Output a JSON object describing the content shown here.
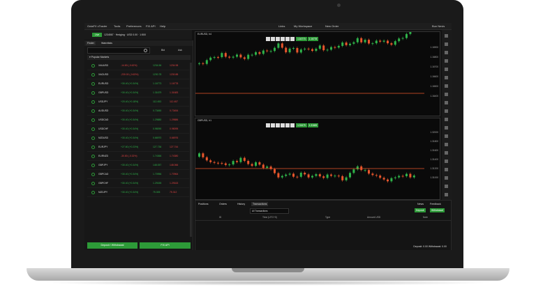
{
  "menu": [
    "OctaFX cTrader",
    "Tools",
    "Preferences",
    "FIX API",
    "Help"
  ],
  "menu_right": [
    "Links",
    "My Workspace",
    "New Order",
    "Bun Nevis"
  ],
  "account": {
    "live": "Live",
    "info": "1234567 · Hedging · USD 0.00 · 1:500"
  },
  "left_tabs": [
    "Finder",
    "Watchlists"
  ],
  "watchlist_headers": {
    "bid": "Bid",
    "ask": "Ask"
  },
  "group": "Popular Markets",
  "rows": [
    {
      "sym": "XAUUSD",
      "chg": "-14.80 (-0.62%)",
      "bid": "1234.56",
      "ask": "1234.98",
      "dir": "neg"
    },
    {
      "sym": "XAGUSD",
      "chg": "-230.00 (-0.63%)",
      "bid": "1230.78",
      "ask": "1230.88",
      "dir": "neg"
    },
    {
      "sym": "EURUSD",
      "chg": "+30.40 (+0.34%)",
      "bid": "1.16773",
      "ask": "1.16778",
      "dir": "pos"
    },
    {
      "sym": "GBPUSD",
      "chg": "+30.40 (+0.34%)",
      "bid": "1.31679",
      "ask": "1.31683",
      "dir": "pos"
    },
    {
      "sym": "USDJPY",
      "chg": "+20.40 (+0.18%)",
      "bid": "112.453",
      "ask": "112.457",
      "dir": "pos"
    },
    {
      "sym": "AUDUSD",
      "chg": "+30.40 (+0.34%)",
      "bid": "0.73450",
      "ask": "0.73454",
      "dir": "pos"
    },
    {
      "sym": "USDCAD",
      "chg": "+30.40 (+0.34%)",
      "bid": "1.29880",
      "ask": "1.29886",
      "dir": "pos"
    },
    {
      "sym": "USDCHF",
      "chg": "+30.40 (+0.34%)",
      "bid": "0.98090",
      "ask": "0.98095",
      "dir": "pos"
    },
    {
      "sym": "NZDUSD",
      "chg": "+30.40 (+0.34%)",
      "bid": "0.66970",
      "ask": "0.66976",
      "dir": "pos"
    },
    {
      "sym": "EURJPY",
      "chg": "+27.60 (+0.23%)",
      "bid": "127.736",
      "ask": "127.744",
      "dir": "pos"
    },
    {
      "sym": "EURNZD",
      "chg": "-30.80 (-0.32%)",
      "bid": "1.74366",
      "ask": "1.74380",
      "dir": "neg"
    },
    {
      "sym": "GBPJPY",
      "chg": "+30.40 (+0.34%)",
      "bid": "148.057",
      "ask": "148.066",
      "dir": "pos"
    },
    {
      "sym": "GBPCAD",
      "chg": "+30.40 (+0.34%)",
      "bid": "1.70956",
      "ask": "1.70964",
      "dir": "pos"
    },
    {
      "sym": "GBPCHF",
      "chg": "+30.40 (+0.34%)",
      "bid": "1.29155",
      "ask": "1.29163",
      "dir": "pos"
    },
    {
      "sym": "NZDJPY",
      "chg": "+30.40 (+0.34%)",
      "bid": "75.305",
      "ask": "75.312",
      "dir": "pos"
    }
  ],
  "buttons": {
    "deposit": "Deposit / Withdrawal",
    "fix": "FIX API"
  },
  "chart1": {
    "symbol": "EURUSD, h4",
    "buy": "1.16778",
    "sell": "1.16773",
    "axis": [
      "1.16900",
      "1.16800",
      "1.16700",
      "1.16600",
      "1.16500",
      "1.16400"
    ]
  },
  "chart2": {
    "symbol": "GBPUSD, h1",
    "buy": "1.31683",
    "sell": "1.31679",
    "axis": [
      "1.32000",
      "1.31800",
      "1.31600",
      "1.31400",
      "1.31200",
      "1.31000"
    ]
  },
  "bottom": {
    "tabs": [
      "Positions",
      "Orders",
      "History",
      "Transactions"
    ],
    "right": [
      "News",
      "Feedback"
    ],
    "select": "All Transactions",
    "columns": [
      "ID",
      "Time (UTC+0)",
      "Type",
      "Amount USD",
      "Note"
    ],
    "deposit_btn": "Deposit",
    "withdraw_btn": "Withdrawal",
    "summary": "Deposit: 0.00   Withdrawal: 0.00"
  }
}
